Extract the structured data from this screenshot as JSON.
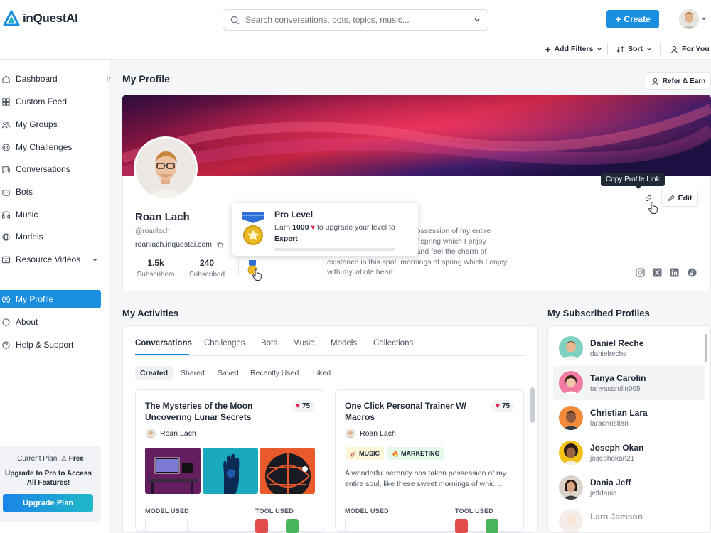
{
  "app": {
    "name": "inQuestAI"
  },
  "search": {
    "placeholder": "Search conversations, bots, topics, music..."
  },
  "header": {
    "create_label": "Create"
  },
  "filters": {
    "add_filters": "Add Filters",
    "sort": "Sort",
    "for_you": "For You"
  },
  "sidebar": {
    "items": [
      {
        "label": "Dashboard",
        "icon": "home-icon"
      },
      {
        "label": "Custom Feed",
        "icon": "grid-icon"
      },
      {
        "label": "My Groups",
        "icon": "group-icon"
      },
      {
        "label": "My Challenges",
        "icon": "target-icon"
      },
      {
        "label": "Conversations",
        "icon": "chat-icon"
      },
      {
        "label": "Bots",
        "icon": "bot-icon"
      },
      {
        "label": "Music",
        "icon": "headphones-icon"
      },
      {
        "label": "Models",
        "icon": "globe-icon"
      },
      {
        "label": "Resource Videos",
        "icon": "video-icon"
      }
    ],
    "bottom_items": [
      {
        "label": "My Profile",
        "icon": "user-circle-icon",
        "active": true
      },
      {
        "label": "About",
        "icon": "info-icon"
      },
      {
        "label": "Help & Support",
        "icon": "help-icon"
      }
    ],
    "plan": {
      "current_label": "Current Plan:",
      "current_value": "Free",
      "upgrade_text": "Upgrade to Pro to Access All Features!",
      "upgrade_button": "Upgrade Plan"
    }
  },
  "page": {
    "title": "My Profile",
    "refer_label": "Refer & Earn"
  },
  "profile": {
    "name": "Roan Lach",
    "handle": "@roanlach",
    "link": "roanlach.inquestai.com",
    "subscribers_value": "1.5k",
    "subscribers_label": "Subscribers",
    "subscribed_value": "240",
    "subscribed_label": "Subscribed",
    "bio": "...ken possession of my entire ...ngs of spring which I enjoy ...lone, and feel the charm of existence in this spot. mornings of spring which I enjoy with my whole heart.",
    "bio_lines": [
      "ken possession of my entire",
      "ngs of spring which I enjoy",
      "lone, and feel the charm of",
      "existence in this spot. mornings of spring which I enjoy",
      "with my whole heart."
    ],
    "copy_tooltip": "Copy Profile Link",
    "edit_label": "Edit",
    "socials": [
      "instagram-icon",
      "x-icon",
      "linkedin-icon",
      "tiktok-icon"
    ]
  },
  "pro_level": {
    "title": "Pro Level",
    "earn": "Earn",
    "amount": "1000",
    "text_after": "to upgrade your level to",
    "level": "Expert",
    "progress": 0
  },
  "activities": {
    "title": "My Activities",
    "tabs": [
      "Conversations",
      "Challenges",
      "Bots",
      "Music",
      "Models",
      "Collections"
    ],
    "active_tab": "Conversations",
    "chips": [
      "Created",
      "Shared",
      "Saved",
      "Recently Used",
      "Liked"
    ],
    "cards": [
      {
        "title": "The Mysteries of the Moon Uncovering Lunar Secrets",
        "likes": "75",
        "author": "Roan Lach",
        "model_label": "MODEL USED",
        "tool_label": "TOOL USED"
      },
      {
        "title": "One Click Personal Trainer W/ Macros",
        "likes": "75",
        "author": "Roan Lach",
        "tags": [
          "MUSIC",
          "MARKETING"
        ],
        "description": "A wonderful serenity has taken possession of my entire soul, like these sweet mornings of whic...",
        "model_label": "MODEL USED",
        "tool_label": "TOOL USED"
      }
    ]
  },
  "subscribed": {
    "title": "My Subscribed Profiles",
    "profiles": [
      {
        "name": "Daniel Reche",
        "handle": "danielreche"
      },
      {
        "name": "Tanya Carolin",
        "handle": "tanyacarolin005"
      },
      {
        "name": "Christian Lara",
        "handle": "larachristian"
      },
      {
        "name": "Joseph Okan",
        "handle": "josephokan21"
      },
      {
        "name": "Dania Jeff",
        "handle": "jeffdania"
      },
      {
        "name": "Lara Jamson",
        "handle": ""
      }
    ]
  },
  "colors": {
    "accent": "#1a8fe0",
    "heart": "#e11d48",
    "music_tag_bg": "#fdf6d8",
    "marketing_tag_bg": "#e4f7e9"
  }
}
